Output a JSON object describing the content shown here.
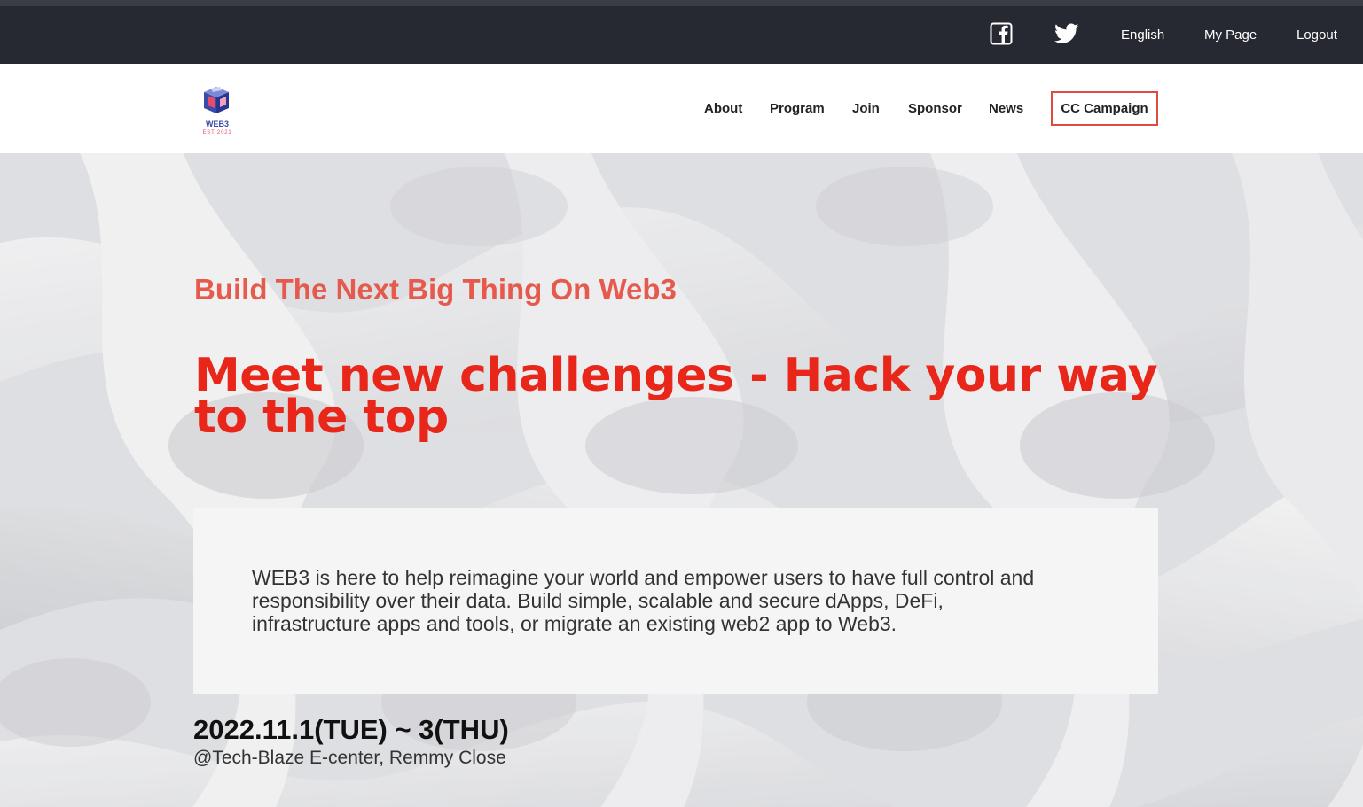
{
  "topbar": {
    "icons": [
      "facebook-icon",
      "twitter-icon"
    ],
    "language": "English",
    "my_page": "My Page",
    "logout": "Logout"
  },
  "nav": {
    "logo_text": "WEB3",
    "logo_subtext": "EST 2021",
    "items": [
      "About",
      "Program",
      "Join",
      "Sponsor",
      "News"
    ],
    "cta": "CC Campaign"
  },
  "hero": {
    "tagline": "Build The Next Big Thing On Web3",
    "headline": "Meet new challenges - Hack your way to the top",
    "description": "WEB3 is here to help reimagine your world and empower users to have full control and responsibility over their data. Build simple, scalable and secure dApps, DeFi, infrastructure apps and tools, or migrate an existing web2 app to Web3.",
    "date": "2022.11.1(TUE) ~ 3(THU)",
    "venue": "@Tech-Blaze E-center, Remmy Close"
  },
  "colors": {
    "topbar_bg": "#262931",
    "accent": "#e8261a",
    "tagline": "#e55a4c",
    "cta_border": "#e04b3f"
  }
}
